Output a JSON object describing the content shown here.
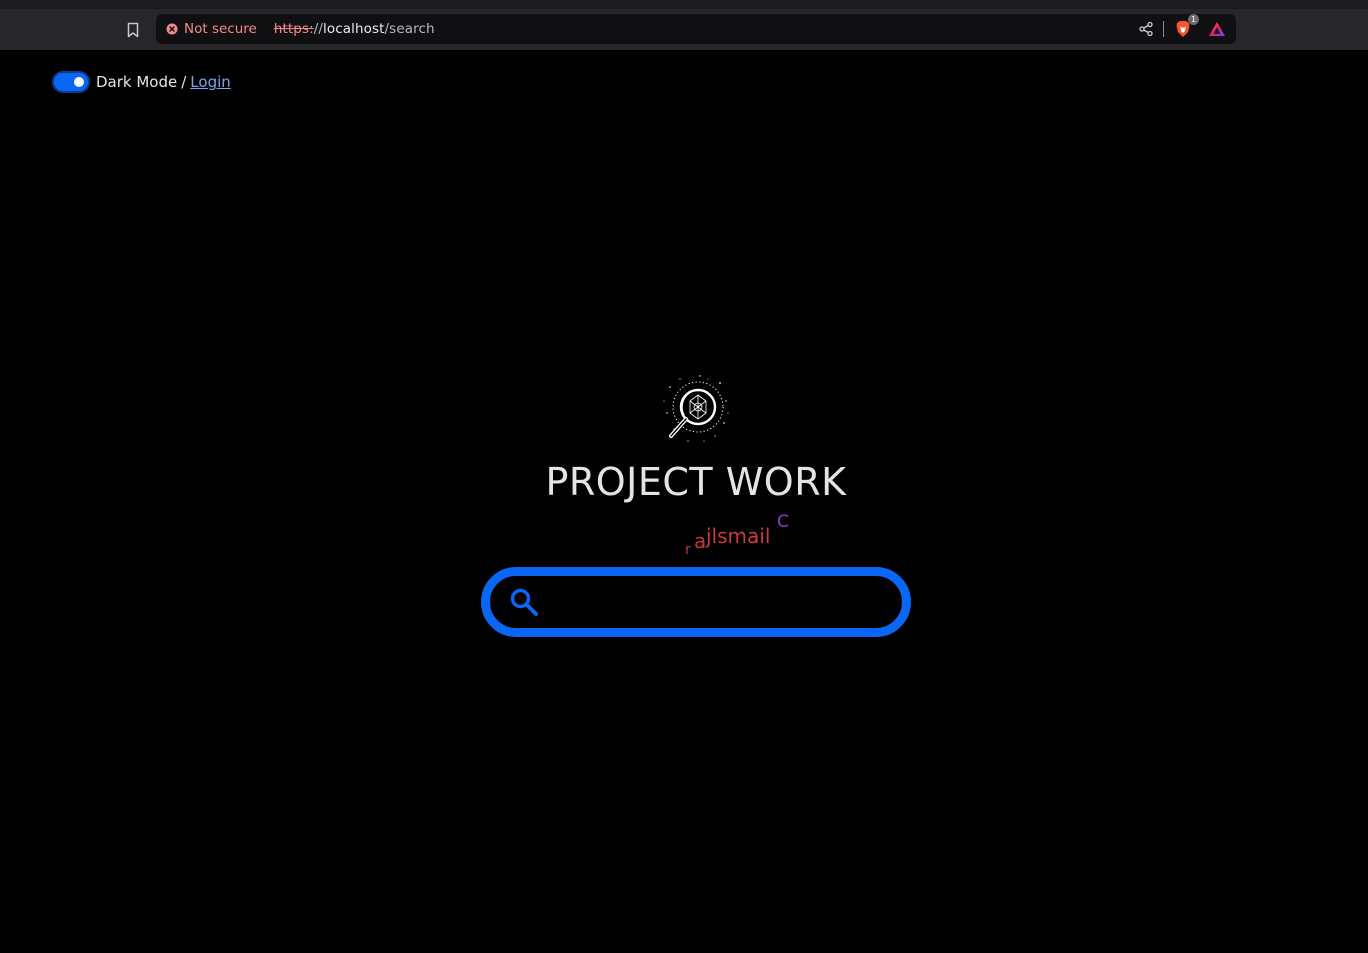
{
  "browser": {
    "security_label": "Not secure",
    "url_scheme": "https:",
    "url_sep": "//",
    "url_host": "localhost",
    "url_path": "/search",
    "shields_count": "1",
    "colors": {
      "insecure": "#f28a8a",
      "toolbar": "#27272b",
      "urlbar": "#101012"
    },
    "icons": [
      "bookmark-icon",
      "insecure-icon",
      "share-icon",
      "brave-shields-icon",
      "brave-rewards-icon"
    ]
  },
  "page": {
    "dark_mode_label": "Dark Mode",
    "separator": "/",
    "login_label": "Login",
    "dark_mode_enabled": true,
    "title": "PROJECT WORK",
    "credit": {
      "r": "r",
      "a": "a",
      "main": "jlsmail",
      "c": "C"
    },
    "search": {
      "value": "",
      "placeholder": ""
    },
    "colors": {
      "accent": "#0a66f5",
      "background": "#000000",
      "credit_red": "#cb3b3f",
      "credit_purple": "#8a3bd0"
    }
  }
}
